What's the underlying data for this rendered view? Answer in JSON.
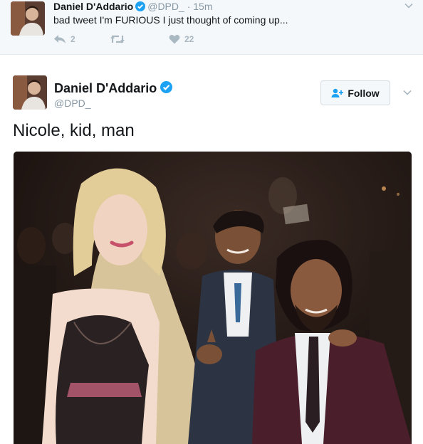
{
  "collapsed_tweet": {
    "author_name": "Daniel D'Addario",
    "handle": "@DPD_",
    "separator": "·",
    "time": "15m",
    "text": "bad tweet I'm FURIOUS I just thought of coming up...",
    "reply_count": "2",
    "retweet_count": "",
    "like_count": "22",
    "icons": {
      "reply": "reply-icon",
      "retweet": "retweet-icon",
      "like": "heart-icon",
      "more": "chevron-down-icon",
      "verified": "verified-badge-icon"
    }
  },
  "tweet": {
    "author_name": "Daniel D'Addario",
    "handle": "@DPD_",
    "follow_label": "Follow",
    "text": "Nicole, kid, man",
    "icons": {
      "follow": "add-user-icon",
      "more": "chevron-down-icon",
      "verified": "verified-badge-icon"
    }
  },
  "colors": {
    "verified": "#1da1f2",
    "follow_icon": "#1da1f2",
    "action_gray": "#aab8c2",
    "meta_gray": "#8899a6"
  }
}
